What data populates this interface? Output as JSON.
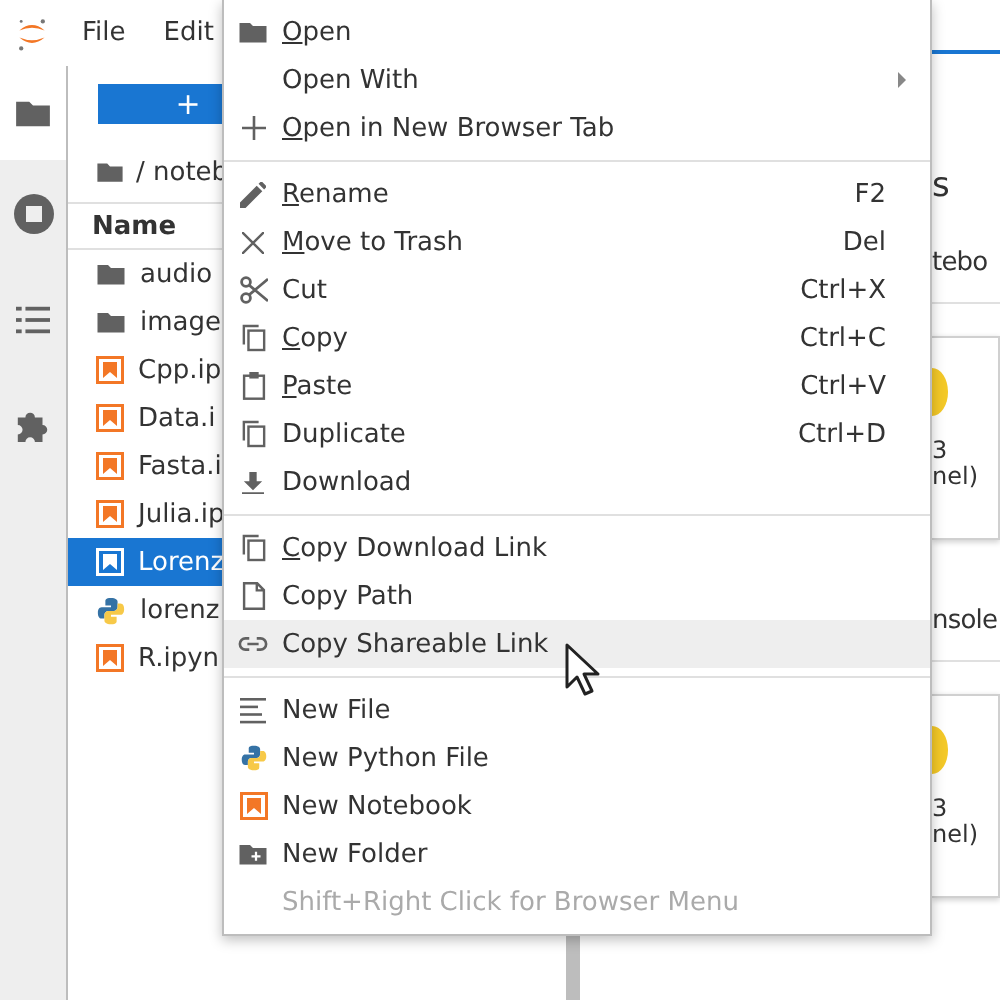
{
  "topbar": {
    "menus": [
      "File",
      "Edit"
    ]
  },
  "file_browser": {
    "new_button": "+",
    "path": "/ noteb",
    "column": "Name",
    "rows": [
      {
        "name": "audio",
        "kind": "folder",
        "selected": false
      },
      {
        "name": "image",
        "kind": "folder",
        "selected": false
      },
      {
        "name": "Cpp.ip",
        "kind": "notebook",
        "selected": false
      },
      {
        "name": "Data.i",
        "kind": "notebook",
        "selected": false
      },
      {
        "name": "Fasta.i",
        "kind": "notebook",
        "selected": false
      },
      {
        "name": "Julia.ip",
        "kind": "notebook",
        "selected": false
      },
      {
        "name": "Lorenz",
        "kind": "notebook",
        "selected": true
      },
      {
        "name": "lorenz",
        "kind": "python",
        "selected": false
      },
      {
        "name": "R.ipyn",
        "kind": "notebook",
        "selected": false
      }
    ]
  },
  "launcher": {
    "heading": "s",
    "sections": [
      {
        "title": "tebo",
        "card": {
          "line_1": "3",
          "line_2": "nel)"
        }
      },
      {
        "title": "nsole",
        "card": {
          "line_1": "3",
          "line_2": "nel)"
        }
      }
    ]
  },
  "context_menu": {
    "groups": [
      {
        "items": [
          {
            "label": "Open",
            "mnemonic": true,
            "submenu": false,
            "disabled": false,
            "selected": false
          },
          {
            "label": "Open With",
            "mnemonic": false,
            "submenu": true,
            "disabled": false,
            "selected": false
          },
          {
            "label": "Open in New Browser Tab",
            "mnemonic": true,
            "submenu": false,
            "disabled": false,
            "selected": false
          }
        ]
      },
      {
        "items": [
          {
            "label": "Rename",
            "shortcut": "F2",
            "mnemonic": true,
            "submenu": false,
            "disabled": false,
            "selected": false
          },
          {
            "label": "Move to Trash",
            "shortcut": "Del",
            "mnemonic": true,
            "submenu": false,
            "disabled": false,
            "selected": false
          },
          {
            "label": "Cut",
            "shortcut": "Ctrl+X",
            "mnemonic": false,
            "submenu": false,
            "disabled": false,
            "selected": false
          },
          {
            "label": "Copy",
            "shortcut": "Ctrl+C",
            "mnemonic": true,
            "submenu": false,
            "disabled": false,
            "selected": false
          },
          {
            "label": "Paste",
            "shortcut": "Ctrl+V",
            "mnemonic": true,
            "submenu": false,
            "disabled": false,
            "selected": false
          },
          {
            "label": "Duplicate",
            "shortcut": "Ctrl+D",
            "mnemonic": false,
            "submenu": false,
            "disabled": false,
            "selected": false
          },
          {
            "label": "Download",
            "mnemonic": false,
            "submenu": false,
            "disabled": false,
            "selected": false
          }
        ]
      },
      {
        "items": [
          {
            "label": "Copy Download Link",
            "mnemonic": true,
            "submenu": false,
            "disabled": false,
            "selected": false
          },
          {
            "label": "Copy Path",
            "mnemonic": false,
            "submenu": false,
            "disabled": false,
            "selected": false
          },
          {
            "label": "Copy Shareable Link",
            "mnemonic": false,
            "submenu": false,
            "disabled": false,
            "selected": true
          }
        ]
      },
      {
        "items": [
          {
            "label": "New File",
            "mnemonic": false,
            "submenu": false,
            "disabled": false,
            "selected": false
          },
          {
            "label": "New Python File",
            "mnemonic": false,
            "submenu": false,
            "disabled": false,
            "selected": false
          },
          {
            "label": "New Notebook",
            "mnemonic": false,
            "submenu": false,
            "disabled": false,
            "selected": false
          },
          {
            "label": "New Folder",
            "mnemonic": false,
            "submenu": false,
            "disabled": false,
            "selected": false
          },
          {
            "label": "Shift+Right Click for Browser Menu",
            "mnemonic": false,
            "submenu": false,
            "disabled": true,
            "selected": false
          }
        ]
      }
    ]
  }
}
